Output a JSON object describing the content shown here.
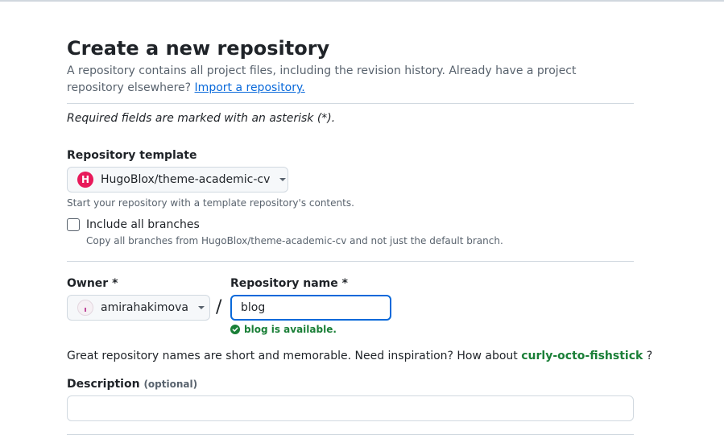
{
  "page": {
    "title": "Create a new repository",
    "subtitle": "A repository contains all project files, including the revision history. Already have a project repository elsewhere?",
    "import_link": "Import a repository.",
    "required_note": "Required fields are marked with an asterisk (*)."
  },
  "template": {
    "label": "Repository template",
    "selected": "HugoBlox/theme-academic-cv",
    "logo_letter": "H",
    "hint": "Start your repository with a template repository's contents.",
    "include_branches_label": "Include all branches",
    "include_branches_checked": false,
    "include_branches_hint": "Copy all branches from HugoBlox/theme-academic-cv and not just the default branch."
  },
  "owner": {
    "label": "Owner *",
    "value": "amirahakimova"
  },
  "separator": "/",
  "repo_name": {
    "label": "Repository name *",
    "value": "blog",
    "availability": "blog is available."
  },
  "suggestion": {
    "text_before": "Great repository names are short and memorable. Need inspiration? How about",
    "name": "curly-octo-fishstick",
    "text_after": "?"
  },
  "description": {
    "label": "Description",
    "optional": "(optional)",
    "value": ""
  },
  "colors": {
    "accent": "#0969da",
    "success": "#1a7f37",
    "template_logo": "#e8195a"
  },
  "icons": {
    "template_logo": "hugoblox-logo-icon",
    "owner_avatar": "avatar-icon",
    "dropdown": "caret-down-icon",
    "available": "check-circle-fill-icon"
  }
}
